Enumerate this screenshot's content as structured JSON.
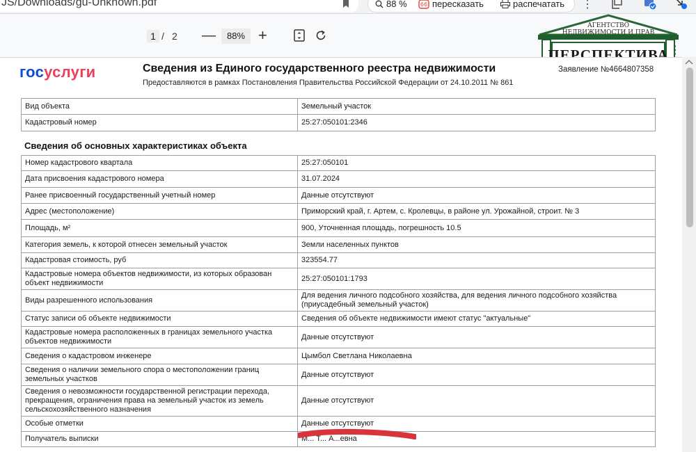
{
  "browser": {
    "url_fragment": "JS/Downloads/gu-Unknown.pdf",
    "ext_zoom": "88 %",
    "ext_retell": "пересказать",
    "ext_print": "распечатать"
  },
  "pdf_toolbar": {
    "current_page": "1",
    "separator": "/",
    "total_pages": "2",
    "zoom_minus": "—",
    "zoom": "88%",
    "zoom_plus": "+"
  },
  "watermark": {
    "top_line1": "АГЕНТСТВО",
    "top_line2": "НЕДВИЖИМОСТИ И ПРАВ",
    "main": "ПЕРСПЕКТИВА"
  },
  "document": {
    "logo_part1": "гос",
    "logo_part2": "услуги",
    "title": "Сведения из Единого государственного реестра недвижимости",
    "subtitle": "Предоставляются в рамках Постановления Правительства Российской Федерации от 24.10.2011 № 861",
    "statement": "Заявление №4664807358",
    "section_title": "Сведения об основных характеристиках объекта"
  },
  "table_top": [
    {
      "k": "Вид объекта",
      "v": "Земельный участок"
    },
    {
      "k": "Кадастровый номер",
      "v": "25:27:050101:2346"
    }
  ],
  "table_main": [
    {
      "k": "Номер кадастрового квартала",
      "v": "25:27:050101"
    },
    {
      "k": "Дата присвоения кадастрового номера",
      "v": "31.07.2024"
    },
    {
      "k": "Ранее присвоенный государственный учетный номер",
      "v": "Данные отсутствуют"
    },
    {
      "k": "Адрес (местоположение)",
      "v": "Приморский край, г. Артем, с. Кролевцы, в районе ул. Урожайной, строит. № 3"
    },
    {
      "k": "Площадь, м²",
      "v": "900, Уточненная площадь, погрешность 10.5"
    },
    {
      "k": "Категория земель, к которой отнесен земельный участок",
      "v": "Земли населенных пунктов"
    },
    {
      "k": "Кадастровая стоимость, руб",
      "v": "323554.77"
    },
    {
      "k": "Кадастровые номера объектов недвижимости, из которых образован объект недвижимости",
      "v": "25:27:050101:1793"
    },
    {
      "k": "Виды разрешенного использования",
      "v": "Для ведения личного подсобного хозяйства, для ведения личного подсобного хозяйства (приусадебный земельный участок)"
    },
    {
      "k": "Статус записи об объекте недвижимости",
      "v": "Сведения об объекте недвижимости имеют статус \"актуальные\""
    },
    {
      "k": "Кадастровые номера расположенных в границах земельного участка объектов недвижимости",
      "v": "Данные отсутствуют"
    },
    {
      "k": "Сведения о кадастровом инженере",
      "v": "Цымбол Светлана Николаевна"
    },
    {
      "k": "Сведения о наличии земельного спора о местоположении границ земельных участков",
      "v": "Данные отсутствуют"
    },
    {
      "k": "Сведения о невозможности государственной регистрации перехода, прекращения, ограничения права на земельный участок из земель сельскохозяйственного назначения",
      "v": "Данные отсутствуют"
    },
    {
      "k": "Особые отметки",
      "v": "Данные отсутствуют"
    },
    {
      "k": "Получатель выписки",
      "v": "М... Т... А...евна"
    }
  ]
}
